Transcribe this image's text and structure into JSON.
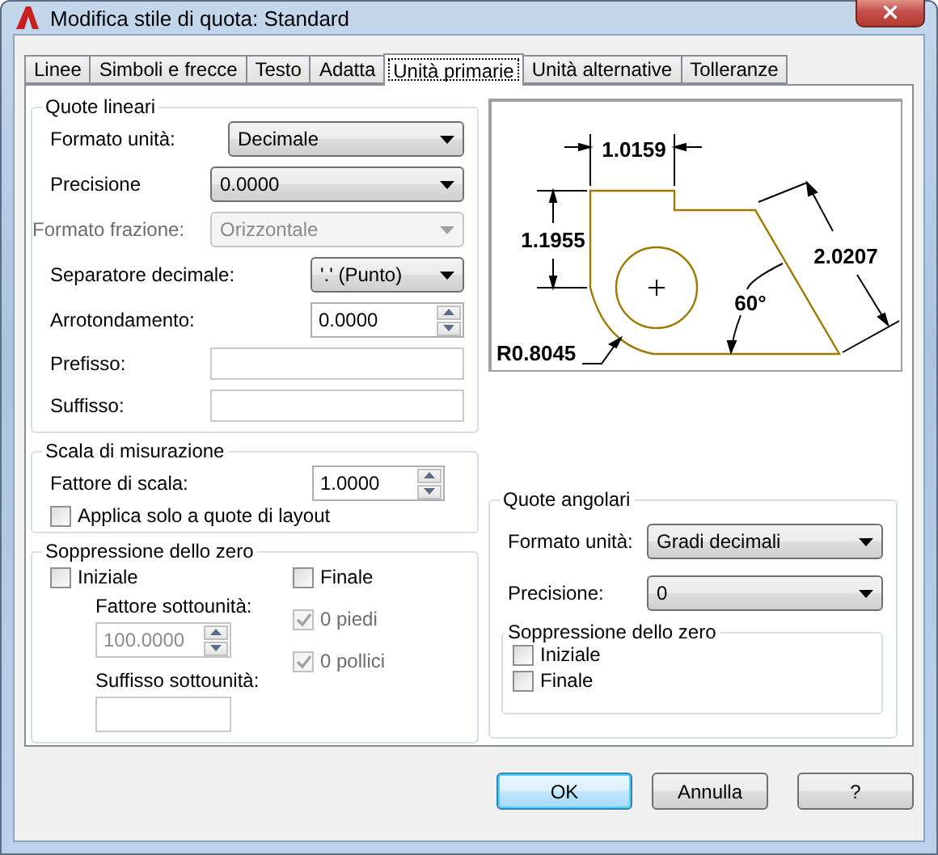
{
  "window": {
    "title": "Modifica stile di quota: Standard"
  },
  "tabs": [
    {
      "label": "Linee",
      "selected": false
    },
    {
      "label": "Simboli e frecce",
      "selected": false
    },
    {
      "label": "Testo",
      "selected": false
    },
    {
      "label": "Adatta",
      "selected": false
    },
    {
      "label": "Unità primarie",
      "selected": true
    },
    {
      "label": "Unità alternative",
      "selected": false
    },
    {
      "label": "Tolleranze",
      "selected": false
    }
  ],
  "linear": {
    "title": "Quote lineari",
    "fields": [
      {
        "kind": "dropdown",
        "label": "Formato unità:",
        "value": "Decimale",
        "disabled": false
      },
      {
        "kind": "dropdown",
        "label": "Precisione",
        "value": "0.0000",
        "disabled": false
      },
      {
        "kind": "dropdown",
        "label": "Formato frazione:",
        "value": "Orizzontale",
        "disabled": true
      },
      {
        "kind": "dropdown",
        "label": "Separatore decimale:",
        "value": "'.' (Punto)",
        "disabled": false
      },
      {
        "kind": "spinner",
        "label": "Arrotondamento:",
        "value": "0.0000",
        "disabled": false
      },
      {
        "kind": "text",
        "label": "Prefisso:"
      },
      {
        "kind": "text",
        "label": "Suffisso:"
      }
    ]
  },
  "scale": {
    "title": "Scala di misurazione",
    "factor": {
      "label": "Fattore di scala:",
      "value": "1.0000"
    },
    "layout_only": {
      "label": "Applica solo a quote di layout",
      "checked": false
    }
  },
  "zero": {
    "title": "Soppressione dello zero",
    "leading": {
      "label": "Iniziale",
      "checked": false
    },
    "trailing": {
      "label": "Finale",
      "checked": false
    },
    "subunit_factor": {
      "label": "Fattore sottounità:",
      "value": "100.0000",
      "disabled": true
    },
    "subunit_suffix": {
      "label": "Suffisso sottounità:"
    },
    "feet": {
      "label": "0 piedi",
      "checked": true,
      "disabled": true
    },
    "inches": {
      "label": "0 pollici",
      "checked": true,
      "disabled": true
    }
  },
  "preview": {
    "labels": [
      "1.0159",
      "1.1955",
      "2.0207",
      "60°",
      "R0.8045"
    ]
  },
  "angular": {
    "title": "Quote angolari",
    "fields": [
      {
        "kind": "dropdown",
        "label": "Formato unità:",
        "value": "Gradi decimali",
        "disabled": false
      },
      {
        "kind": "dropdown",
        "label": "Precisione:",
        "value": "0",
        "disabled": false
      }
    ],
    "zero": {
      "title": "Soppressione dello zero",
      "options": [
        {
          "label": "Iniziale",
          "checked": false
        },
        {
          "label": "Finale",
          "checked": false
        }
      ]
    }
  },
  "buttons": [
    {
      "label": "OK",
      "default": true
    },
    {
      "label": "Annulla",
      "default": false
    },
    {
      "label": "?",
      "default": false
    }
  ]
}
